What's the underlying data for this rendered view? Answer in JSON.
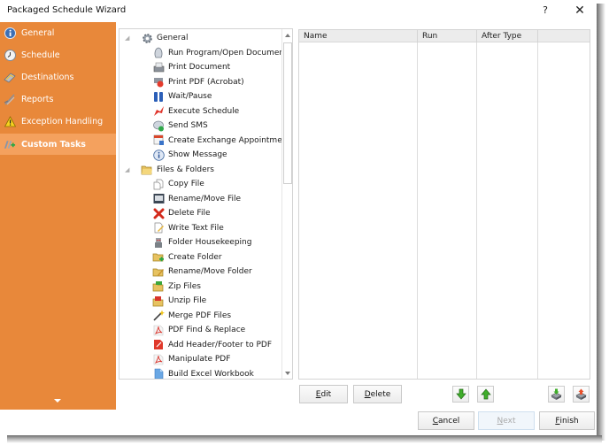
{
  "window": {
    "title": "Packaged Schedule Wizard",
    "help_label": "?",
    "close_label": "✕"
  },
  "sidebar": {
    "items": [
      {
        "label": "General",
        "icon": "info-icon",
        "active": false
      },
      {
        "label": "Schedule",
        "icon": "clock-icon",
        "active": false
      },
      {
        "label": "Destinations",
        "icon": "destination-icon",
        "active": false
      },
      {
        "label": "Reports",
        "icon": "reports-icon",
        "active": false
      },
      {
        "label": "Exception Handling",
        "icon": "warning-icon",
        "active": false
      },
      {
        "label": "Custom Tasks",
        "icon": "custom-tasks-icon",
        "active": true
      }
    ],
    "more_icon": "chevron-down-icon"
  },
  "task_tree": {
    "groups": [
      {
        "label": "General",
        "icon": "gear-icon",
        "expander": "◢",
        "items": [
          {
            "label": "Run Program/Open Document",
            "icon": "run-program-icon"
          },
          {
            "label": "Print Document",
            "icon": "printer-icon"
          },
          {
            "label": "Print PDF (Acrobat)",
            "icon": "print-pdf-icon"
          },
          {
            "label": "Wait/Pause",
            "icon": "pause-icon"
          },
          {
            "label": "Execute Schedule",
            "icon": "execute-schedule-icon"
          },
          {
            "label": "Send SMS",
            "icon": "sms-icon"
          },
          {
            "label": "Create Exchange Appointment",
            "icon": "calendar-icon"
          },
          {
            "label": "Show Message",
            "icon": "info-icon"
          }
        ]
      },
      {
        "label": "Files & Folders",
        "icon": "folder-icon",
        "expander": "◢",
        "items": [
          {
            "label": "Copy File",
            "icon": "copy-file-icon"
          },
          {
            "label": "Rename/Move File",
            "icon": "rename-file-icon"
          },
          {
            "label": "Delete File",
            "icon": "delete-icon"
          },
          {
            "label": "Write Text File",
            "icon": "write-text-icon"
          },
          {
            "label": "Folder Housekeeping",
            "icon": "housekeeping-icon"
          },
          {
            "label": "Create Folder",
            "icon": "create-folder-icon"
          },
          {
            "label": "Rename/Move Folder",
            "icon": "rename-folder-icon"
          },
          {
            "label": "Zip Files",
            "icon": "zip-icon"
          },
          {
            "label": "Unzip File",
            "icon": "unzip-icon"
          },
          {
            "label": "Merge PDF Files",
            "icon": "merge-pdf-icon"
          },
          {
            "label": "PDF Find & Replace",
            "icon": "pdf-icon"
          },
          {
            "label": "Add Header/Footer to PDF",
            "icon": "pdf-header-icon"
          },
          {
            "label": "Manipulate PDF",
            "icon": "pdf-icon"
          },
          {
            "label": "Build Excel Workbook",
            "icon": "excel-workbook-icon"
          }
        ]
      }
    ]
  },
  "tasks_table": {
    "columns": [
      "Name",
      "Run",
      "After Type",
      ""
    ],
    "rows": []
  },
  "actions": {
    "edit": {
      "pre": "",
      "key": "E",
      "post": "dit"
    },
    "delete": {
      "pre": "",
      "key": "D",
      "post": "elete"
    },
    "move_down_icon": "arrow-down-icon",
    "move_up_icon": "arrow-up-icon",
    "import_icon": "import-icon",
    "export_icon": "export-icon"
  },
  "footer": {
    "cancel": {
      "pre": "",
      "key": "C",
      "post": "ancel"
    },
    "next": {
      "pre": "",
      "key": "N",
      "post": "ext",
      "disabled": true
    },
    "finish": {
      "pre": "",
      "key": "F",
      "post": "inish"
    }
  },
  "colors": {
    "sidebar_bg": "#e8883a",
    "sidebar_active": "#f4a15e"
  }
}
